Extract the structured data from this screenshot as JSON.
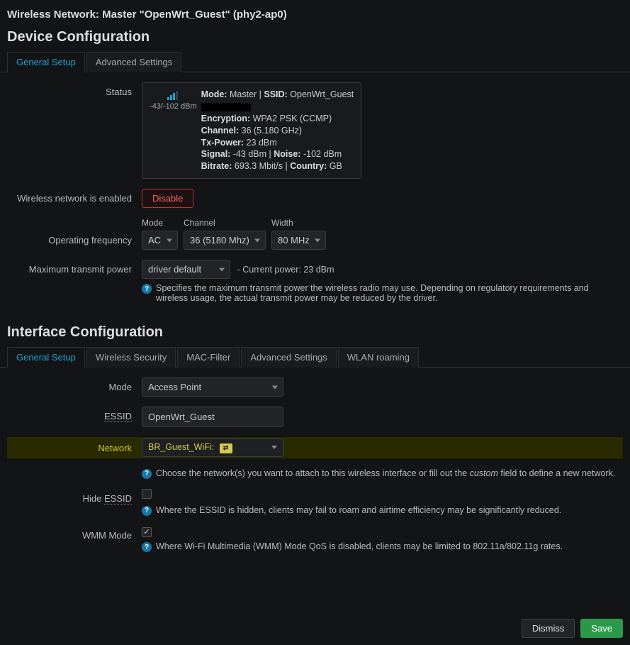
{
  "title": "Wireless Network: Master \"OpenWrt_Guest\" (phy2-ap0)",
  "device": {
    "heading": "Device Configuration",
    "tabs": [
      "General Setup",
      "Advanced Settings"
    ],
    "active_tab": 0,
    "status_label": "Status",
    "status": {
      "signal_text": "-43/-102 dBm",
      "mode_k": "Mode:",
      "mode_v": "Master",
      "ssid_k": "SSID:",
      "ssid_v": "OpenWrt_Guest",
      "enc_k": "Encryption:",
      "enc_v": "WPA2 PSK (CCMP)",
      "chan_k": "Channel:",
      "chan_v": "36 (5.180 GHz)",
      "txp_k": "Tx-Power:",
      "txp_v": "23 dBm",
      "sig_k": "Signal:",
      "sig_v": "-43 dBm",
      "noise_k": "Noise:",
      "noise_v": "-102 dBm",
      "bitrate_k": "Bitrate:",
      "bitrate_v": "693.3 Mbit/s",
      "country_k": "Country:",
      "country_v": "GB"
    },
    "enabled_label": "Wireless network is enabled",
    "disable_btn": "Disable",
    "freq_label": "Operating frequency",
    "freq": {
      "mode_l": "Mode",
      "mode_v": "AC",
      "chan_l": "Channel",
      "chan_v": "36 (5180 Mhz)",
      "width_l": "Width",
      "width_v": "80 MHz"
    },
    "power_label": "Maximum transmit power",
    "power_value": "driver default",
    "power_note": "- Current power: 23 dBm",
    "power_help": "Specifies the maximum transmit power the wireless radio may use. Depending on regulatory requirements and wireless usage, the actual transmit power may be reduced by the driver."
  },
  "iface": {
    "heading": "Interface Configuration",
    "tabs": [
      "General Setup",
      "Wireless Security",
      "MAC-Filter",
      "Advanced Settings",
      "WLAN roaming"
    ],
    "active_tab": 0,
    "mode_label": "Mode",
    "mode_value": "Access Point",
    "essid_label": "ESSID",
    "essid_value": "OpenWrt_Guest",
    "network_label": "Network",
    "network_value": "BR_Guest_WiFi:",
    "network_help_1": "Choose the network(s) you want to attach to this wireless interface or fill out the ",
    "network_help_em": "custom",
    "network_help_2": " field to define a new network.",
    "hide_label_pre": "Hide ",
    "hide_label_abbr": "ESSID",
    "hide_checked": false,
    "hide_help": "Where the ESSID is hidden, clients may fail to roam and airtime efficiency may be significantly reduced.",
    "wmm_label": "WMM Mode",
    "wmm_checked": true,
    "wmm_help": "Where Wi-Fi Multimedia (WMM) Mode QoS is disabled, clients may be limited to 802.11a/802.11g rates."
  },
  "footer": {
    "dismiss": "Dismiss",
    "save": "Save"
  }
}
